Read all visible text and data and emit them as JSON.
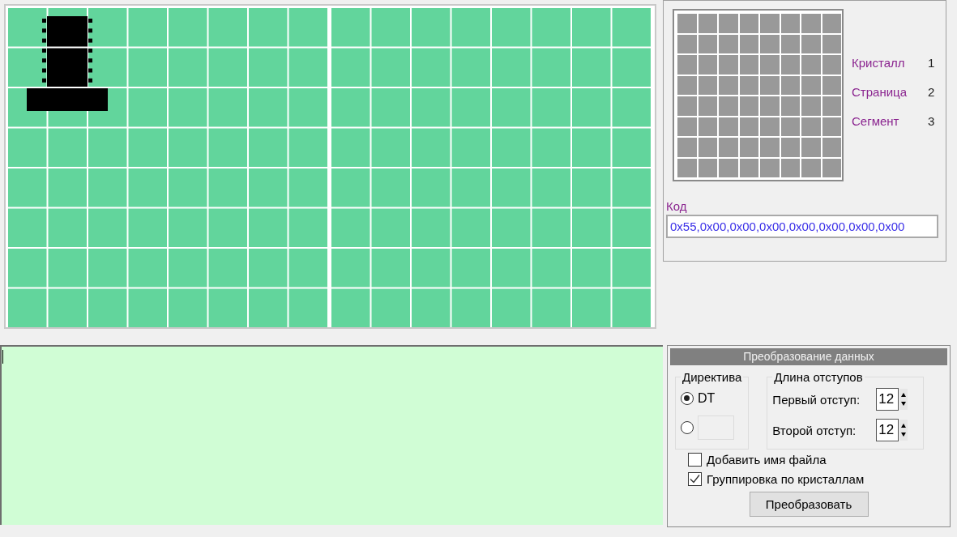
{
  "preview": {
    "rows": [
      {
        "label": "Кристалл",
        "value": "1"
      },
      {
        "label": "Страница",
        "value": "2"
      },
      {
        "label": "Сегмент",
        "value": "3"
      }
    ]
  },
  "code": {
    "label": "Код",
    "value": "0x55,0x00,0x00,0x00,0x00,0x00,0x00,0x00"
  },
  "conversion": {
    "title": "Преобразование данных",
    "directive": {
      "title": "Директива",
      "options": [
        {
          "kind": "label",
          "label": "DT",
          "selected": true
        },
        {
          "kind": "field",
          "selected": false
        }
      ]
    },
    "indents": {
      "title": "Длина отступов",
      "fields": [
        {
          "label": "Первый отступ:",
          "value": "12"
        },
        {
          "label": "Второй отступ:",
          "value": "12"
        }
      ]
    },
    "checkboxes": [
      {
        "label": "Добавить имя файла",
        "checked": false
      },
      {
        "label": "Группировка по кристаллам",
        "checked": true
      }
    ],
    "button": "Преобразовать"
  }
}
